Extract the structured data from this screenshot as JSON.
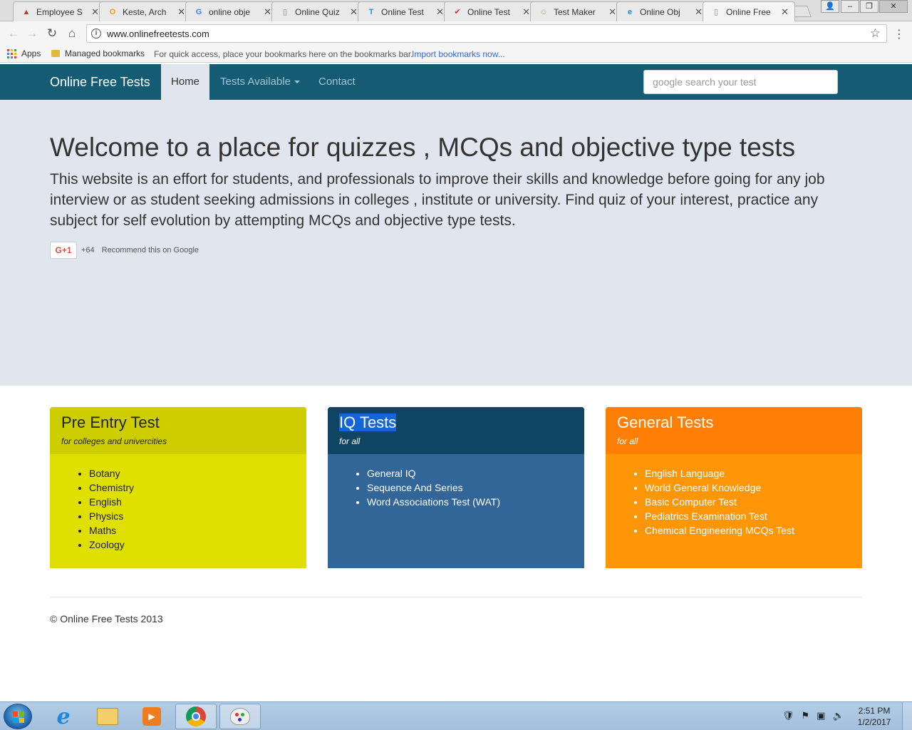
{
  "browser": {
    "tabs": [
      {
        "title": "Employee S",
        "icon": "chart-icon",
        "color": "#c0392b",
        "glyph": "▲"
      },
      {
        "title": "Keste, Arch",
        "icon": "outlook-icon",
        "color": "#f39c12",
        "glyph": "O"
      },
      {
        "title": "online obje",
        "icon": "google-icon",
        "color": "#4285f4",
        "glyph": "G"
      },
      {
        "title": "Online Quiz",
        "icon": "document-icon",
        "color": "#888888",
        "glyph": "▯"
      },
      {
        "title": "Online Test",
        "icon": "t-logo-icon",
        "color": "#1e9be0",
        "glyph": "T"
      },
      {
        "title": "Online Test",
        "icon": "checkbox-icon",
        "color": "#d9342b",
        "glyph": "✔"
      },
      {
        "title": "Test Maker",
        "icon": "face-icon",
        "color": "#c9a36a",
        "glyph": "☺"
      },
      {
        "title": "Online Obj",
        "icon": "ie-icon",
        "color": "#1e88d6",
        "glyph": "e"
      },
      {
        "title": "Online Free",
        "icon": "document-icon",
        "color": "#888888",
        "glyph": "▯"
      }
    ],
    "active_tab": 8,
    "url": "www.onlinefreetests.com",
    "bookmarks": {
      "apps_label": "Apps",
      "folder_label": "Managed bookmarks",
      "hint": "For quick access, place your bookmarks here on the bookmarks bar.",
      "import_link": "Import bookmarks now..."
    }
  },
  "site": {
    "brand": "Online Free Tests",
    "nav": {
      "home": "Home",
      "tests": "Tests Available",
      "contact": "Contact"
    },
    "search_placeholder": "google search your test",
    "hero": {
      "title": "Welcome to a place for quizzes , MCQs and objective type tests",
      "body": "This website is an effort for students, and professionals to improve their skills and knowledge before going for any job interview or as student seeking admissions in colleges , institute or university. Find quiz of your interest, practice any subject for self evolution by attempting MCQs and objective type tests.",
      "gplus_label": "G+1",
      "gplus_count": "+64",
      "gplus_text": "Recommend this on Google"
    },
    "panels": [
      {
        "title": "Pre Entry Test",
        "subtitle": "for colleges and univercities",
        "items": [
          "Botany",
          "Chemistry",
          "English",
          "Physics",
          "Maths",
          "Zoology"
        ]
      },
      {
        "title": "IQ Tests",
        "subtitle": "for all",
        "items": [
          "General IQ",
          "Sequence And Series",
          "Word Associations Test (WAT)"
        ]
      },
      {
        "title": "General Tests",
        "subtitle": "for all",
        "items": [
          "English Language",
          "World General Knowledge",
          "Basic Computer Test",
          "Pediatrics Examination Test",
          "Chemical Engineering MCQs Test"
        ]
      }
    ],
    "footer": "© Online Free Tests 2013"
  },
  "taskbar": {
    "time": "2:51 PM",
    "date": "1/2/2017"
  },
  "colors": {
    "navbar": "#155b73",
    "jumbotron": "#e1e6ee",
    "panel_yellow": "#dfdf00",
    "panel_blue": "#326699",
    "panel_orange": "#ff9607"
  }
}
